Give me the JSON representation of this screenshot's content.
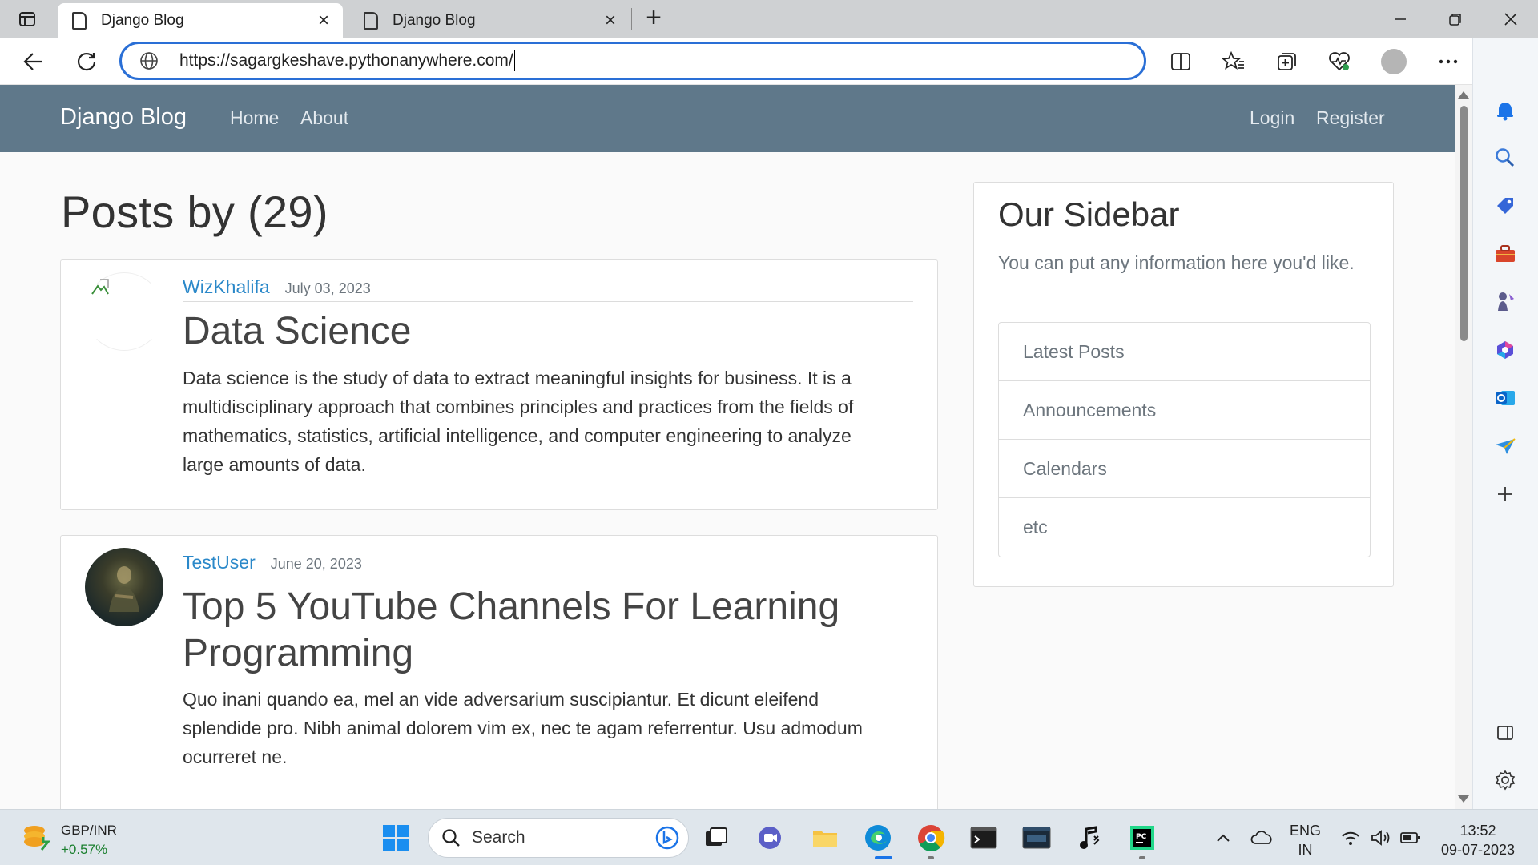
{
  "browser": {
    "tabs": [
      {
        "label": "Django Blog",
        "active": true
      },
      {
        "label": "Django Blog",
        "active": false
      }
    ],
    "url": "https://sagargkeshave.pythonanywhere.com/"
  },
  "site": {
    "brand": "Django Blog",
    "nav_left": [
      "Home",
      "About"
    ],
    "nav_right": [
      "Login",
      "Register"
    ],
    "heading": "Posts by (29)",
    "posts": [
      {
        "author": "WizKhalifa",
        "date": "July 03, 2023",
        "title": "Data Science",
        "body": "Data science is the study of data to extract meaningful insights for business. It is a multidisciplinary approach that combines principles and practices from the fields of mathematics, statistics, artificial intelligence, and computer engineering to analyze large amounts of data."
      },
      {
        "author": "TestUser",
        "date": "June 20, 2023",
        "title": "Top 5 YouTube Channels For Learning Programming",
        "body": "Quo inani quando ea, mel an vide adversarium suscipiantur. Et dicunt eleifend splendide pro. Nibh animal dolorem vim ex, nec te agam referrentur. Usu admodum ocurreret ne."
      }
    ],
    "sidebar": {
      "title": "Our Sidebar",
      "description": "You can put any information here you'd like.",
      "items": [
        "Latest Posts",
        "Announcements",
        "Calendars",
        "etc"
      ]
    }
  },
  "taskbar": {
    "ticker_symbol": "GBP/INR",
    "ticker_change": "+0.57%",
    "search_placeholder": "Search",
    "language": "ENG",
    "region": "IN",
    "time": "13:52",
    "date": "09-07-2023"
  },
  "colors": {
    "navbar": "#5f788a",
    "link": "#2a88c9",
    "url_focus": "#2a6fd6"
  }
}
